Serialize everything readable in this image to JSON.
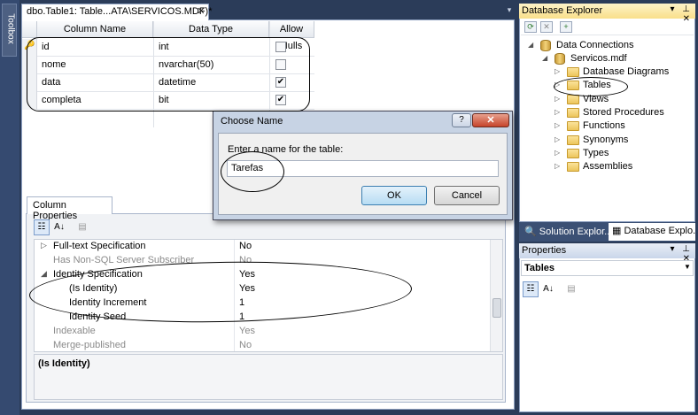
{
  "toolbox": {
    "label": "Toolbox"
  },
  "document": {
    "tab_title": "dbo.Table1: Table...ATA\\SERVICOS.MDF)*",
    "tab_close": "✕",
    "dropdown": "▾"
  },
  "grid": {
    "headers": [
      "Column Name",
      "Data Type",
      "Allow Nulls"
    ],
    "rows": [
      {
        "name": "id",
        "type": "int",
        "allow_nulls": false,
        "primary_key": true
      },
      {
        "name": "nome",
        "type": "nvarchar(50)",
        "allow_nulls": false
      },
      {
        "name": "data",
        "type": "datetime",
        "allow_nulls": true
      },
      {
        "name": "completa",
        "type": "bit",
        "allow_nulls": true
      }
    ]
  },
  "column_properties": {
    "tab": "Column Properties",
    "toolbar": {
      "categorized": "☷",
      "alphabetical": "A↓",
      "pages": "▤"
    },
    "rows": [
      {
        "name": "Full-text Specification",
        "value": "No",
        "expander": "▷",
        "dim": false,
        "indent": false
      },
      {
        "name": "Has Non-SQL Server Subscriber",
        "value": "No",
        "expander": "",
        "dim": true,
        "indent": false
      },
      {
        "name": "Identity Specification",
        "value": "Yes",
        "expander": "◢",
        "dim": false,
        "indent": false
      },
      {
        "name": "(Is Identity)",
        "value": "Yes",
        "expander": "",
        "dim": false,
        "indent": true
      },
      {
        "name": "Identity Increment",
        "value": "1",
        "expander": "",
        "dim": false,
        "indent": true
      },
      {
        "name": "Identity Seed",
        "value": "1",
        "expander": "",
        "dim": false,
        "indent": true
      },
      {
        "name": "Indexable",
        "value": "Yes",
        "expander": "",
        "dim": true,
        "indent": false
      },
      {
        "name": "Merge-published",
        "value": "No",
        "expander": "",
        "dim": true,
        "indent": false
      }
    ],
    "description_title": "(Is Identity)"
  },
  "database_explorer": {
    "title": "Database Explorer",
    "pin_controls": "▾ ⊥ ✕",
    "tree": {
      "root": "Data Connections",
      "db": "Servicos.mdf",
      "folders": [
        "Database Diagrams",
        "Tables",
        "Views",
        "Stored Procedures",
        "Functions",
        "Synonyms",
        "Types",
        "Assemblies"
      ]
    }
  },
  "bottom_tabs": {
    "solution": "Solution Explor...",
    "dbx": "Database Explo..."
  },
  "properties": {
    "title": "Properties",
    "pin_controls": "▾ ⊥ ✕",
    "selected": "Tables"
  },
  "dialog": {
    "title": "Choose Name",
    "help": "?",
    "close": "✕",
    "label": "Enter a name for the table:",
    "input_value": "Tarefas",
    "ok": "OK",
    "cancel": "Cancel"
  },
  "colors": {
    "accent_blue": "#2b3c59",
    "title_gold": "#f9df8a",
    "close_red": "#c6432a"
  }
}
